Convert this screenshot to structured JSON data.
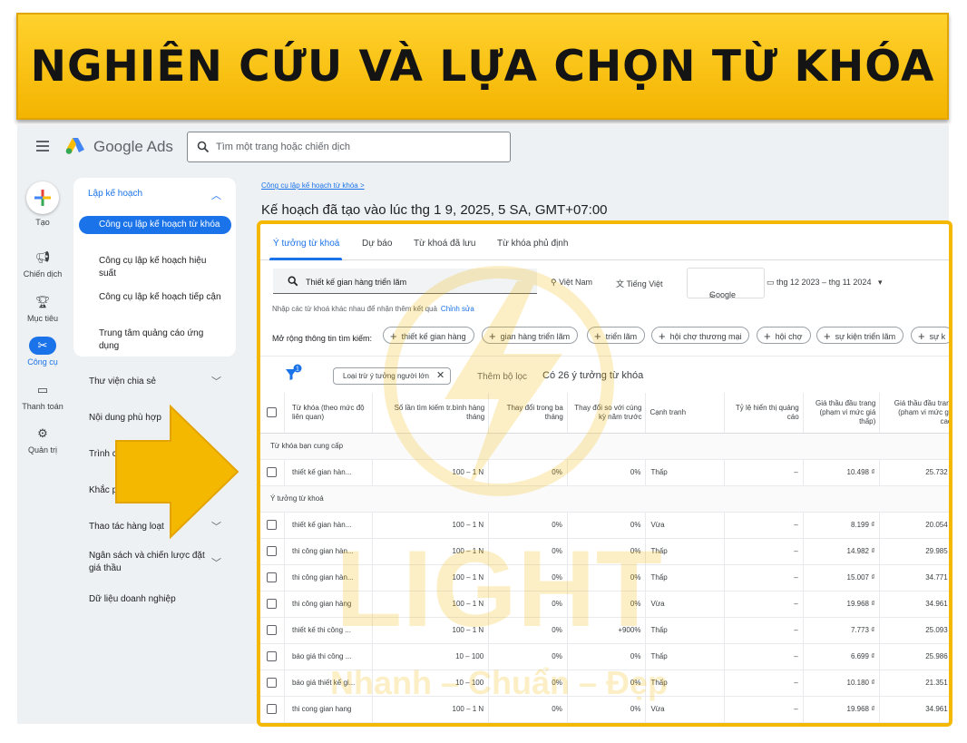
{
  "banner": {
    "title": "NGHIÊN CỨU VÀ LỰA CHỌN TỪ KHÓA"
  },
  "app": {
    "name": "Google Ads"
  },
  "search": {
    "placeholder": "Tìm một trang hoặc chiến dịch"
  },
  "rail": {
    "create_label": "Tạo",
    "items": [
      {
        "label": "Chiến dịch",
        "icon": "megaphone-icon"
      },
      {
        "label": "Mục tiêu",
        "icon": "trophy-icon"
      },
      {
        "label": "Công cụ",
        "icon": "tools-icon"
      },
      {
        "label": "Thanh toán",
        "icon": "credit-card-icon"
      },
      {
        "label": "Quản trị",
        "icon": "gear-icon"
      }
    ]
  },
  "nav": {
    "heading": "Lập kế hoạch",
    "sub_items": [
      "Công cụ lập kế hoạch từ khóa",
      "Công cụ lập kế hoạch hiệu suất",
      "Công cụ lập kế hoạch tiếp cận",
      "Trung tâm quảng cáo ứng dụng"
    ],
    "sections": [
      "Thư viện chia sẻ",
      "Nội dung phù hợp",
      "Trình c",
      "Khắc p",
      "Thao tác hàng loạt",
      "Ngân sách và chiến lược đặt giá thầu",
      "Dữ liệu doanh nghiệp"
    ]
  },
  "breadcrumb": "Công cụ lập kế hoạch từ khóa >",
  "plan_title": "Kế hoạch đã tạo vào lúc thg 1 9, 2025, 5 SA, GMT+07:00",
  "tabs": [
    "Ý tưởng từ khoá",
    "Dự báo",
    "Từ khoá đã lưu",
    "Từ khóa phủ định"
  ],
  "keyword_input": "Thiết kế gian hàng triển lãm",
  "location": "Việt Nam",
  "language": "Tiếng Việt",
  "network": "Google",
  "date_range": "thg 12 2023 – thg 11 2024",
  "hint_text": "Nhập các từ khoá khác nhau để nhận thêm kết quả",
  "hint_link": "Chỉnh sửa",
  "expand_label": "Mở rộng thông tin tìm kiếm:",
  "expand_chips": [
    "thiết kế gian hàng",
    "gian hàng triển lãm",
    "triển lãm",
    "hội chợ thương mại",
    "hội chợ",
    "sự kiện triển lãm",
    "sự k"
  ],
  "filter_badge": "1",
  "filter_chip": "Loại trừ ý tưởng người lớn",
  "add_filter": "Thêm bộ lọc",
  "ideas_count": "Có 26 ý tưởng từ khóa",
  "table": {
    "headers": [
      "Từ khóa (theo mức độ liên quan)",
      "Số lần tìm kiếm tr.bình hàng tháng",
      "Thay đổi trong ba tháng",
      "Thay đổi so với cùng kỳ năm trước",
      "Cạnh tranh",
      "Tỷ lệ hiển thị quảng cáo",
      "Giá thầu đầu trang (phạm vi mức giá thấp)",
      "Giá thầu đầu trang (phạm vi mức giá cao)"
    ],
    "group_provided": "Từ khóa bạn cung cấp",
    "group_ideas": "Ý tưởng từ khoá",
    "provided_rows": [
      [
        "thiết kế gian hàn...",
        "100 – 1 N",
        "0%",
        "0%",
        "Thấp",
        "–",
        "10.498 ₫",
        "25.732 ₫"
      ]
    ],
    "idea_rows": [
      [
        "thiết kế gian hàn...",
        "100 – 1 N",
        "0%",
        "0%",
        "Vừa",
        "–",
        "8.199 ₫",
        "20.054 ₫"
      ],
      [
        "thi công gian hàn...",
        "100 – 1 N",
        "0%",
        "0%",
        "Thấp",
        "–",
        "14.982 ₫",
        "29.985 ₫"
      ],
      [
        "thi công gian hàn...",
        "100 – 1 N",
        "0%",
        "0%",
        "Thấp",
        "–",
        "15.007 ₫",
        "34.771 ₫"
      ],
      [
        "thi công gian hàng",
        "100 – 1 N",
        "0%",
        "0%",
        "Vừa",
        "–",
        "19.968 ₫",
        "34.961 ₫"
      ],
      [
        "thiết kế thi công ...",
        "100 – 1 N",
        "0%",
        "+900%",
        "Thấp",
        "–",
        "7.773 ₫",
        "25.093 ₫"
      ],
      [
        "báo giá thi công ...",
        "10 – 100",
        "0%",
        "0%",
        "Thấp",
        "–",
        "6.699 ₫",
        "25.986 ₫"
      ],
      [
        "báo giá thiết kế gi...",
        "10 – 100",
        "0%",
        "0%",
        "Thấp",
        "–",
        "10.180 ₫",
        "21.351 ₫"
      ],
      [
        "thi cong gian hang",
        "100 – 1 N",
        "0%",
        "0%",
        "Vừa",
        "–",
        "19.968 ₫",
        "34.961 ₫"
      ]
    ]
  },
  "watermark": {
    "brand": "LIGHT",
    "slogan": "Nhanh – Chuẩn – Đẹp"
  },
  "colors": {
    "banner": "#f4b400",
    "accent": "#1a73e8",
    "frame": "#f5b800"
  }
}
